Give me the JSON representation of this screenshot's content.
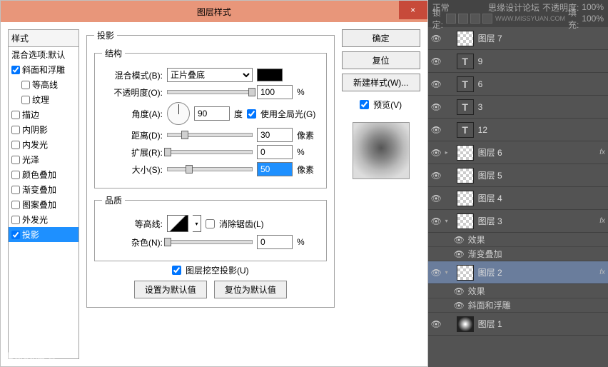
{
  "dialog": {
    "title": "图层样式",
    "close": "×",
    "stylesHeader": "样式",
    "blendDefaults": "混合选项:默认",
    "items": {
      "bevel": "斜面和浮雕",
      "contour": "等高线",
      "texture": "纹理",
      "stroke": "描边",
      "innerShadow": "内阴影",
      "innerGlow": "内发光",
      "satin": "光泽",
      "colorOverlay": "颜色叠加",
      "gradientOverlay": "渐变叠加",
      "patternOverlay": "图案叠加",
      "outerGlow": "外发光",
      "dropShadow": "投影"
    },
    "checked": {
      "bevel": true,
      "dropShadow": true
    },
    "groupShadow": "投影",
    "groupStructure": "结构",
    "blendModeLabel": "混合模式(B):",
    "blendModeValue": "正片叠底",
    "opacityLabel": "不透明度(O):",
    "opacityValue": "100",
    "angleLabel": "角度(A):",
    "angleValue": "90",
    "angleUnit": "度",
    "useGlobalLight": "使用全局光(G)",
    "distanceLabel": "距离(D):",
    "distanceValue": "30",
    "spreadLabel": "扩展(R):",
    "spreadValue": "0",
    "sizeLabel": "大小(S):",
    "sizeValue": "50",
    "pxUnit": "像素",
    "pctUnit": "%",
    "groupQuality": "品质",
    "contourLabel": "等高线:",
    "antiAlias": "消除锯齿(L)",
    "noiseLabel": "杂色(N):",
    "noiseValue": "0",
    "knockout": "图层挖空投影(U)",
    "makeDefault": "设置为默认值",
    "resetDefault": "复位为默认值",
    "ok": "确定",
    "cancel": "复位",
    "newStyle": "新建样式(W)...",
    "preview": "预览(V)"
  },
  "layersPanel": {
    "modeLabel": "正常",
    "opacityLabel": "不透明度:",
    "opacityVal": "100%",
    "lockLabel": "锁定:",
    "fillLabel": "填充:",
    "fillVal": "100%",
    "watermark": "思缘设计论坛",
    "watermarkUrl": "WWW.MISSYUAN.COM",
    "layers": [
      {
        "name": "图层 7",
        "type": "checker"
      },
      {
        "name": "9",
        "type": "txt"
      },
      {
        "name": "6",
        "type": "txt"
      },
      {
        "name": "3",
        "type": "txt"
      },
      {
        "name": "12",
        "type": "txt"
      },
      {
        "name": "图层 6",
        "type": "checker",
        "fx": true
      },
      {
        "name": "图层 5",
        "type": "checker"
      },
      {
        "name": "图层 4",
        "type": "checker"
      },
      {
        "name": "图层 3",
        "type": "checker",
        "fx": true,
        "expanded": true,
        "effects": [
          "效果",
          "渐变叠加"
        ]
      },
      {
        "name": "图层 2",
        "type": "checker",
        "fx": true,
        "active": true,
        "expanded": true,
        "effects": [
          "效果",
          "斜面和浮雕"
        ]
      },
      {
        "name": "图层 1",
        "type": "radial"
      }
    ]
  },
  "baidu": "Baidu贴吧"
}
